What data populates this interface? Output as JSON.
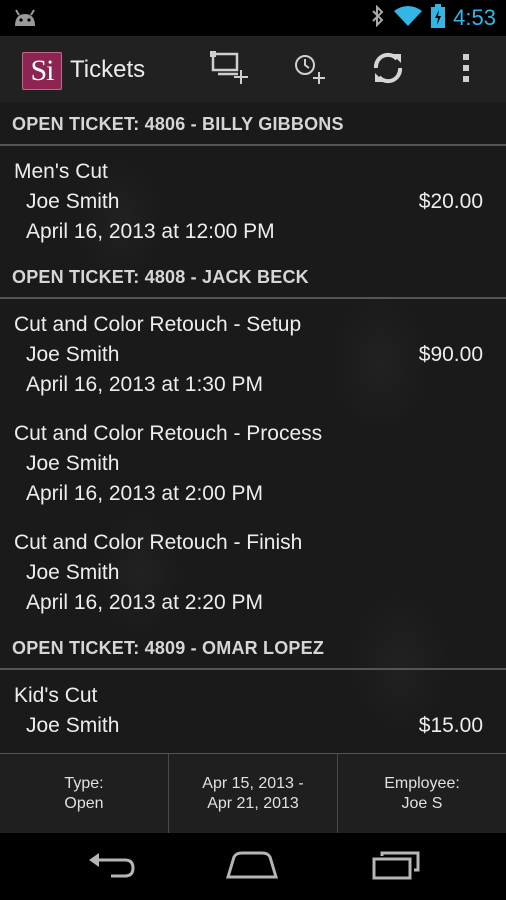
{
  "status_bar": {
    "time": "4:53"
  },
  "action_bar": {
    "logo_text": "Si",
    "title": "Tickets"
  },
  "tickets": [
    {
      "header": "OPEN TICKET: 4806 - BILLY GIBBONS",
      "items": [
        {
          "service": "Men's Cut",
          "employee": "Joe Smith",
          "datetime": "April 16, 2013 at 12:00 PM",
          "price": "$20.00"
        }
      ]
    },
    {
      "header": "OPEN TICKET: 4808 - JACK BECK",
      "items": [
        {
          "service": "Cut and Color Retouch - Setup",
          "employee": "Joe Smith",
          "datetime": "April 16, 2013 at 1:30 PM",
          "price": "$90.00"
        },
        {
          "service": "Cut and Color Retouch - Process",
          "employee": "Joe Smith",
          "datetime": "April 16, 2013 at 2:00 PM",
          "price": ""
        },
        {
          "service": "Cut and Color Retouch - Finish",
          "employee": "Joe Smith",
          "datetime": "April 16, 2013 at 2:20 PM",
          "price": ""
        }
      ]
    },
    {
      "header": "OPEN TICKET: 4809 - OMAR LOPEZ",
      "items": [
        {
          "service": "Kid's Cut",
          "employee": "Joe Smith",
          "datetime": "",
          "price": "$15.00"
        }
      ]
    }
  ],
  "footer": {
    "type_label": "Type:",
    "type_value": "Open",
    "date_line1": "Apr 15, 2013 -",
    "date_line2": "Apr 21, 2013",
    "employee_label": "Employee:",
    "employee_value": "Joe S"
  }
}
